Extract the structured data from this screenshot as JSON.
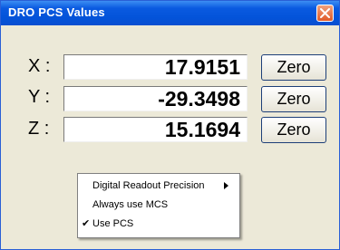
{
  "window": {
    "title": "DRO PCS Values",
    "close_icon": "close-icon"
  },
  "readouts": [
    {
      "axis": "X :",
      "value": "17.9151",
      "button": "Zero"
    },
    {
      "axis": "Y :",
      "value": "-29.3498",
      "button": "Zero"
    },
    {
      "axis": "Z :",
      "value": "15.1694",
      "button": "Zero"
    }
  ],
  "context_menu": {
    "items": [
      {
        "label": "Digital Readout Precision",
        "submenu_icon": "chevron-right-icon",
        "checked": false
      },
      {
        "label": "Always use MCS",
        "checked": false
      },
      {
        "label": "Use PCS",
        "checked": true,
        "check_mark": "✔"
      }
    ]
  },
  "colors": {
    "title_bar": "#0a5ae0",
    "close_button": "#e15a28",
    "dialog_background": "#ece9d8"
  }
}
